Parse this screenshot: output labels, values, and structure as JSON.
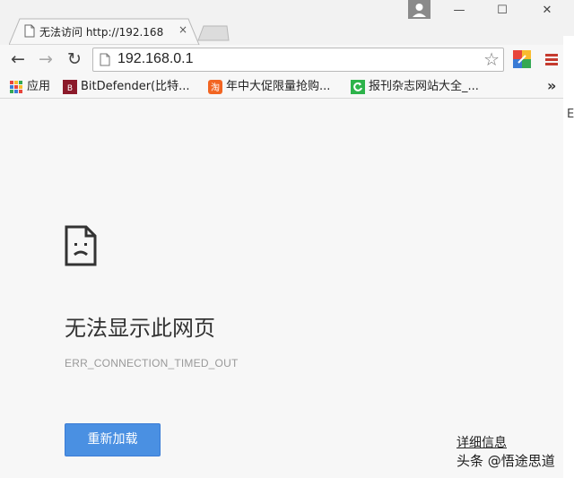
{
  "window": {
    "minimize_glyph": "—",
    "maximize_glyph": "☐",
    "close_glyph": "✕"
  },
  "tab": {
    "title": "无法访问 http://192.168",
    "close_glyph": "×"
  },
  "toolbar": {
    "back_glyph": "←",
    "forward_glyph": "→",
    "reload_glyph": "↻",
    "url": "192.168.0.1",
    "star_glyph": "☆"
  },
  "bookmarks": {
    "apps_label": "应用",
    "items": [
      {
        "label": "BitDefender(比特...",
        "icon": "bitdefender-icon"
      },
      {
        "label": "年中大促限量抢购...",
        "icon": "taobao-icon"
      },
      {
        "label": "报刊杂志网站大全_...",
        "icon": "green-refresh-icon"
      }
    ],
    "more_glyph": "»"
  },
  "error_page": {
    "title": "无法显示此网页",
    "code": "ERR_CONNECTION_TIMED_OUT",
    "reload_label": "重新加载",
    "details_label": "详细信息"
  },
  "watermark": "头条 @悟途思道",
  "right_edge_char": "E",
  "colors": {
    "reload_button": "#4a90e2",
    "page_background": "#f7f7f7"
  }
}
